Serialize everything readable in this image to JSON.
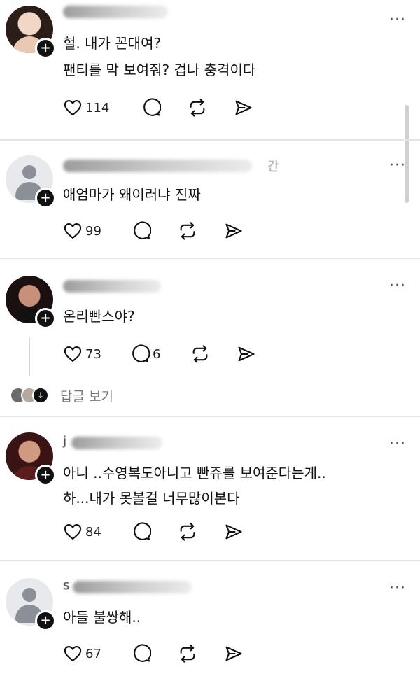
{
  "posts": [
    {
      "username_visible": "",
      "time": "",
      "lines": [
        "헐. 내가 꼰대여?",
        "팬티를 막 보여줘? 겁나 충격이다"
      ],
      "likes": "114",
      "comments": ""
    },
    {
      "username_visible": "",
      "time": "간",
      "lines": [
        "애엄마가 왜이러냐 진짜"
      ],
      "likes": "99",
      "comments": ""
    },
    {
      "username_visible": "",
      "time": "",
      "lines": [
        "온리빤스야?"
      ],
      "likes": "73",
      "comments": "6"
    },
    {
      "username_visible": "j",
      "time": "",
      "lines": [
        "아니 ..수영복도아니고 빤쥬를 보여준다는게..",
        "하...내가 못볼걸 너무많이본다"
      ],
      "likes": "84",
      "comments": ""
    },
    {
      "username_visible": "s",
      "time": "",
      "lines": [
        "아들 불쌍해.."
      ],
      "likes": "67",
      "comments": ""
    }
  ],
  "view_replies_label": "답글 보기",
  "more_label": "···",
  "follow_label": "+",
  "icons": {
    "like": "heart-icon",
    "comment": "comment-icon",
    "repost": "repost-icon",
    "share": "send-icon"
  }
}
